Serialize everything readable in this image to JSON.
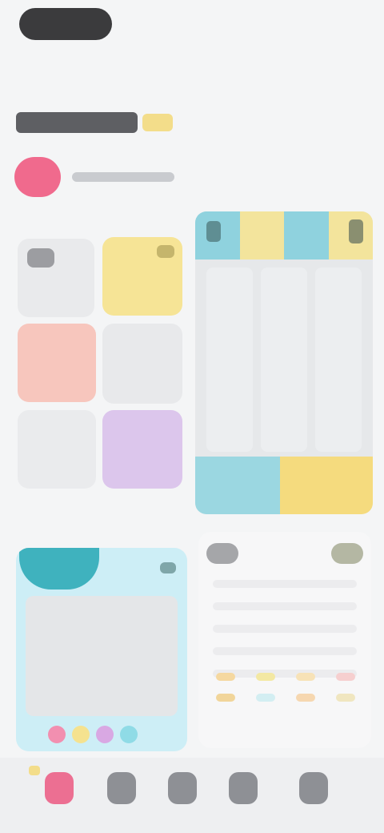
{
  "colors": {
    "background": "#f4f5f6",
    "accent_pink": "#f06a8d",
    "accent_yellow": "#f6e496",
    "accent_teal": "#3fb2be",
    "accent_lilac": "#dcc6ec",
    "accent_peach": "#f7c6bd"
  },
  "icons": {
    "top_pill": "menu-pill-icon",
    "avatar": "avatar-icon",
    "planner_left": "calendar-icon",
    "planner_right": "settings-icon",
    "card_blue_corner": "more-icon",
    "card_white_left": "back-icon",
    "card_white_right": "forward-icon"
  },
  "tabbar": {
    "items": [
      {
        "icon": "home-icon",
        "active": true
      },
      {
        "icon": "grid-icon",
        "active": false
      },
      {
        "icon": "calendar-icon",
        "active": false
      },
      {
        "icon": "chat-icon",
        "active": false
      },
      {
        "icon": "profile-icon",
        "active": false
      }
    ]
  }
}
